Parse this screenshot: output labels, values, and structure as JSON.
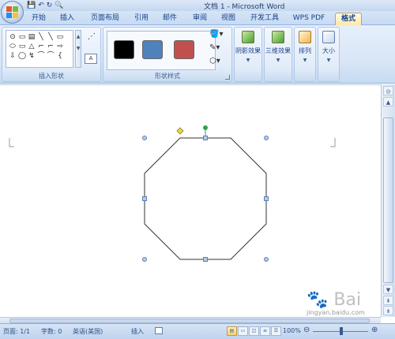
{
  "window": {
    "title": "文档 1 - Microsoft Word"
  },
  "quick_access": {
    "save": "💾",
    "undo": "↶",
    "redo": "↻",
    "print_preview": "🔍"
  },
  "tabs": [
    "开始",
    "插入",
    "页面布局",
    "引用",
    "邮件",
    "审阅",
    "视图",
    "开发工具",
    "WPS PDF",
    "格式"
  ],
  "active_tab": "格式",
  "ribbon": {
    "insert_shapes": {
      "label": "插入形状",
      "shapes": [
        "⊙",
        "▭",
        "▤",
        "╲",
        "╲",
        "▭",
        "",
        "⬭",
        "▭",
        "△",
        "⌐",
        "⌐",
        "⇨",
        "",
        "⇩",
        "◯",
        "↯",
        "⌒",
        "⌒",
        "{",
        ""
      ]
    },
    "shape_styles": {
      "label": "形状样式",
      "swatches": [
        "#000000",
        "#4f81bd",
        "#c0504d"
      ]
    },
    "shadow_effects": {
      "label": "阴影效果"
    },
    "three_d_effects": {
      "label": "三维效果"
    },
    "arrange": {
      "label": "排列"
    },
    "size": {
      "label": "大小"
    }
  },
  "status": {
    "page": "页面: 1/1",
    "words": "字数: 0",
    "language": "英语(美国)",
    "insert_mode": "插入",
    "zoom": "100%"
  },
  "watermark": {
    "text": "jingyan.baidu.com"
  },
  "colors": {
    "ribbon_bg": "#dbe7f8",
    "active_tab": "#fde8a8",
    "shape_stroke": "#333333",
    "handle_blue": "#5b7fb4",
    "rotate_handle": "#2ea54b",
    "adjust_handle": "#e8d84a"
  }
}
